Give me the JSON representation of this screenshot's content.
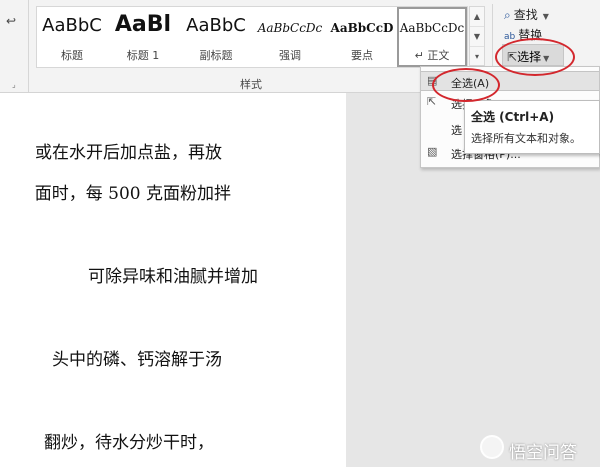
{
  "ribbon": {
    "styles": [
      {
        "preview": "AaBbC",
        "name": "标题"
      },
      {
        "preview": "AaBl",
        "name": "标题 1"
      },
      {
        "preview": "AaBbC",
        "name": "副标题"
      },
      {
        "preview": "AaBbCcDc",
        "name": "强调"
      },
      {
        "preview": "AaBbCcD",
        "name": "要点"
      },
      {
        "preview": "AaBbCcDc",
        "name": "↵ 正文"
      }
    ],
    "group_label": "样式",
    "editing": {
      "find_label": "查找",
      "replace_label": "替换",
      "select_label": "选择"
    }
  },
  "dropdown": {
    "items": [
      {
        "label": "全选(A)"
      },
      {
        "label": "选择对象(O)"
      },
      {
        "label": "选"
      },
      {
        "label": "选择窗格(P)..."
      }
    ]
  },
  "tooltip": {
    "title": "全选 (Ctrl+A)",
    "description": "选择所有文本和对象。"
  },
  "document": {
    "lines": [
      "或在水开后加点盐，再放",
      "面时，每 500 克面粉加拌",
      "可除异味和油腻并增加",
      "头中的磷、钙溶解于汤",
      "翻炒，待水分炒干时，"
    ]
  },
  "watermark": {
    "text": "悟空问答"
  }
}
